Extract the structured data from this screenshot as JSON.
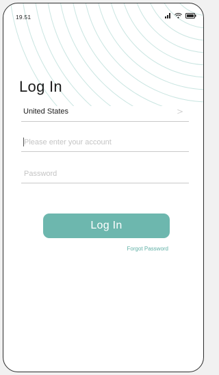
{
  "status_bar": {
    "time": "19.51",
    "icons": [
      "signal-icon",
      "wifi-icon",
      "battery-icon"
    ]
  },
  "page": {
    "title": "Log In"
  },
  "form": {
    "region": "United States",
    "region_chevron": ">",
    "account_placeholder": "Please enter your account",
    "account_value": "",
    "password_placeholder": "Password",
    "password_value": "",
    "submit_label": "Log In",
    "forgot_label": "Forgot Password"
  },
  "colors": {
    "accent": "#6db7ae",
    "link": "#62b1a7",
    "wave": "#c9e5e1",
    "divider": "#c9c9c9"
  }
}
